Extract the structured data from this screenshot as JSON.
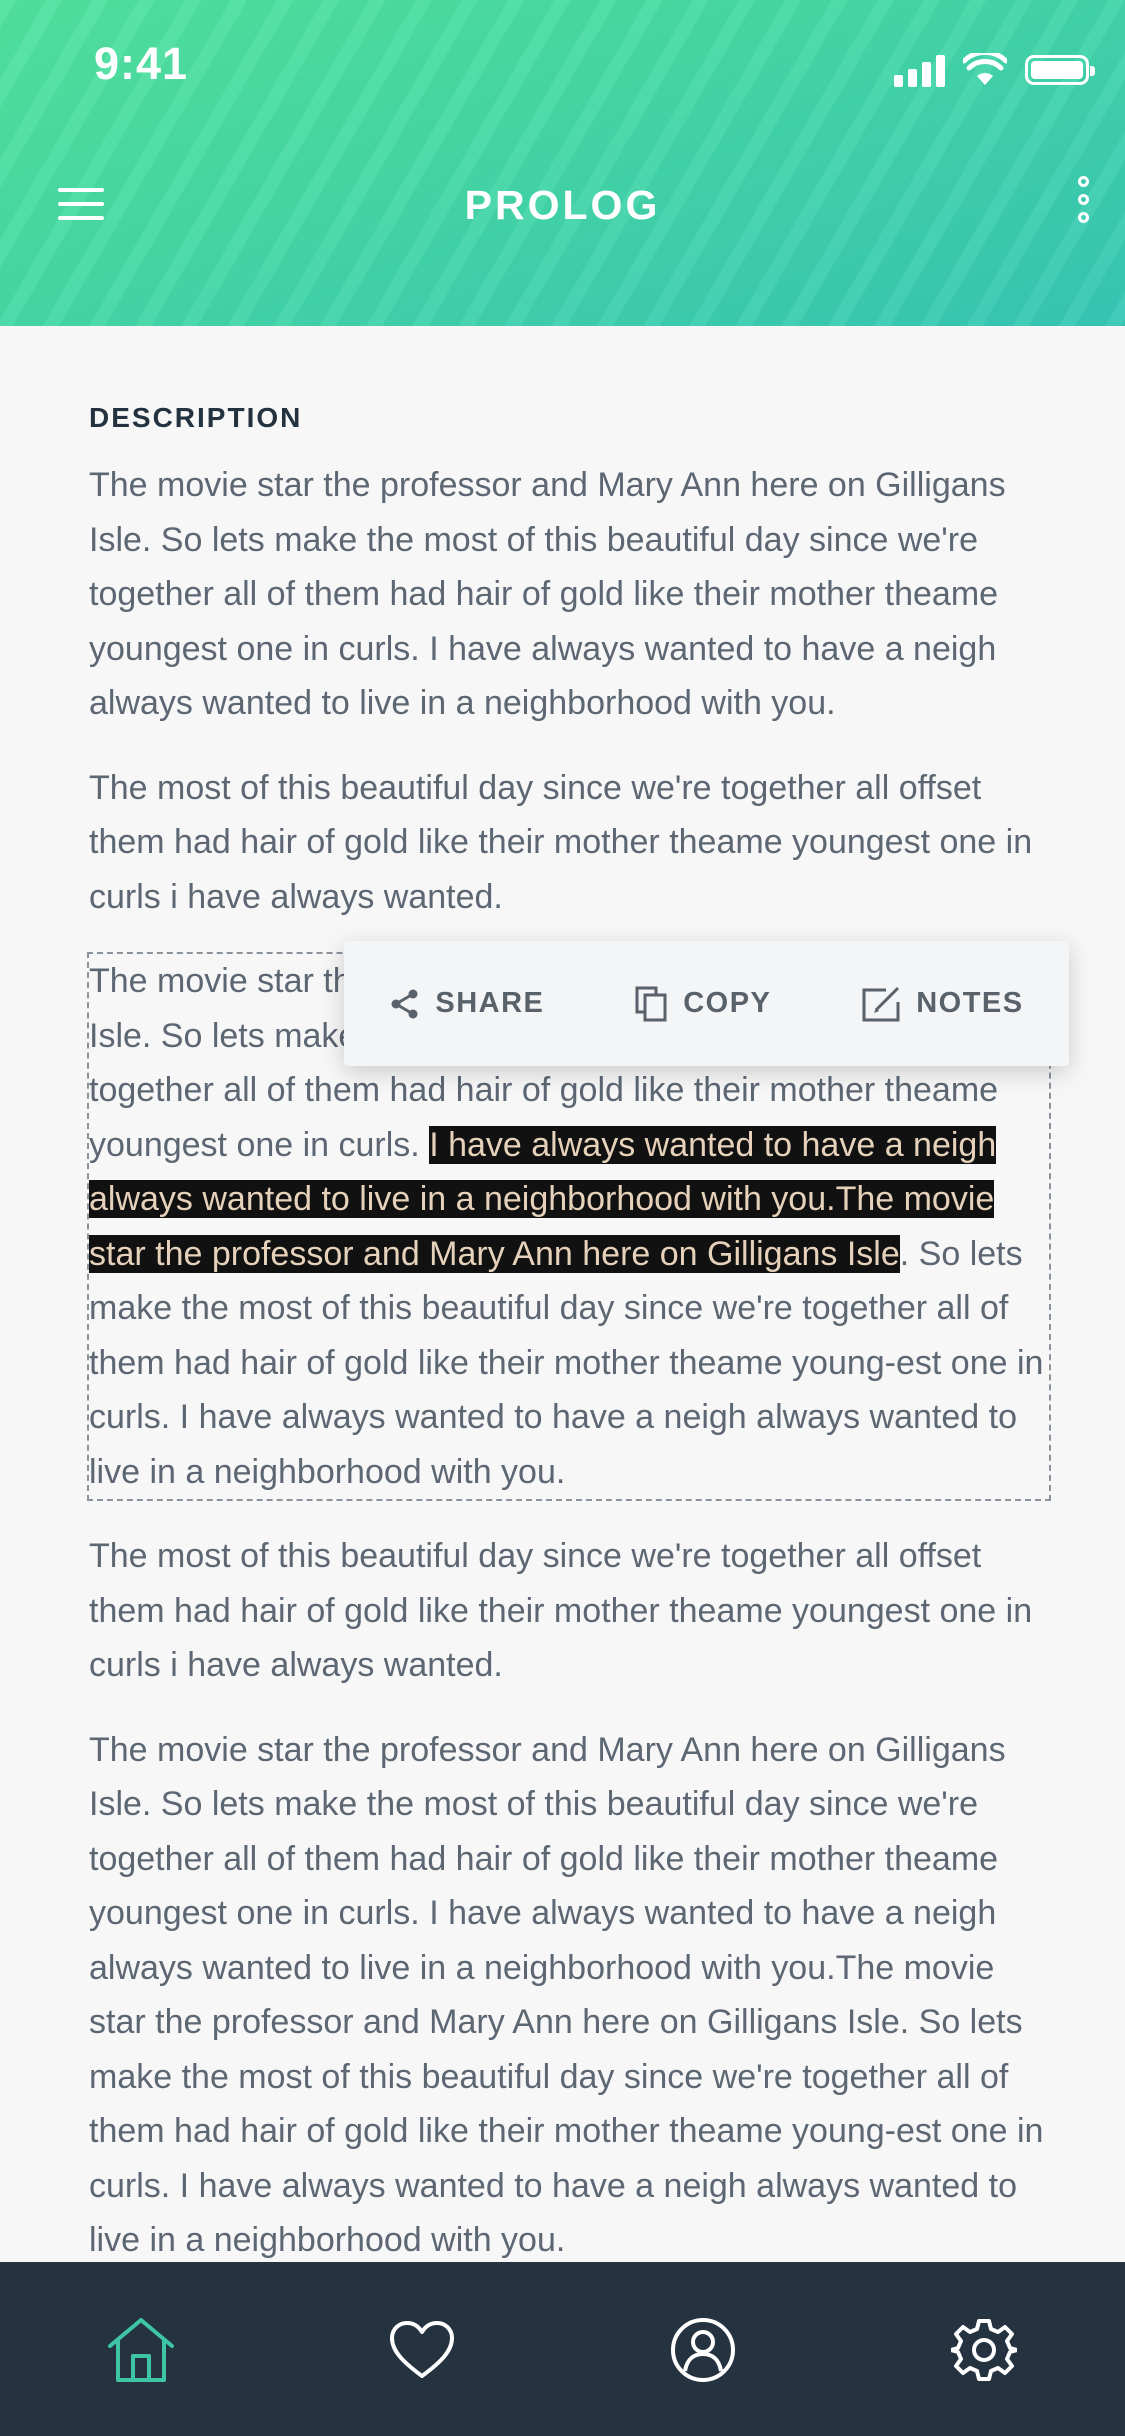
{
  "status_bar": {
    "time": "9:41"
  },
  "header": {
    "title": "PROLOG"
  },
  "content": {
    "heading": "DESCRIPTION",
    "paragraph_1": "The movie star the professor and Mary Ann here on Gilligans Isle. So lets make the most of this beautiful day since we're together all of them had hair of gold like their mother theame youngest one in curls. I have always wanted to have a neigh always wanted to live in a neighborhood with you.",
    "paragraph_2": "The most of this beautiful day since we're together all offset them had hair of gold like their mother theame youngest one in curls i have always wanted.",
    "paragraph_3": {
      "before": "The movie star the professor and Mary Ann here on Gilligans Isle. So lets make the most of this beautiful day since we're together all of them had hair of gold like their mother theame youngest one in curls. ",
      "highlighted": "I have always wanted to have a neigh always wanted to live in a neighborhood with you.The movie star the professor and Mary Ann here on Gilligans Isle",
      "after": ". So lets make the most of this beautiful day since we're together all of them had hair of gold like their mother theame young-est one in curls. I have always wanted to have a neigh always wanted to live in a neighborhood with you."
    },
    "paragraph_4": "The most of this beautiful day since we're together all offset them had hair of gold like their mother theame youngest one in curls i have always wanted.",
    "paragraph_5": "The movie star the professor and Mary Ann here on Gilligans Isle. So lets make the most of this beautiful day since we're together all of them had hair of gold like their mother theame youngest one in curls. I have always wanted to have a neigh always wanted to live in a neighborhood with you.The movie star the professor and Mary Ann here on Gilligans Isle. So lets make the most of this beautiful day since we're together all of them had hair of gold like their mother theame young-est one in curls. I have always wanted to have a neigh always wanted to live in a neighborhood with you."
  },
  "context_menu": {
    "share_label": "SHARE",
    "copy_label": "COPY",
    "notes_label": "NOTES"
  },
  "tab_bar": {
    "items": [
      {
        "icon": "home-icon",
        "active": true
      },
      {
        "icon": "heart-icon",
        "active": false
      },
      {
        "icon": "profile-icon",
        "active": false
      },
      {
        "icon": "gear-icon",
        "active": false
      }
    ]
  },
  "colors": {
    "header_gradient_start": "#52e29e",
    "header_gradient_end": "#36c7b6",
    "text": "#5c6773",
    "heading": "#243240",
    "highlight_bg": "#111111",
    "highlight_text": "#e6d2ba",
    "tabbar_bg": "#253240",
    "active_tab": "#3ec6a4"
  }
}
